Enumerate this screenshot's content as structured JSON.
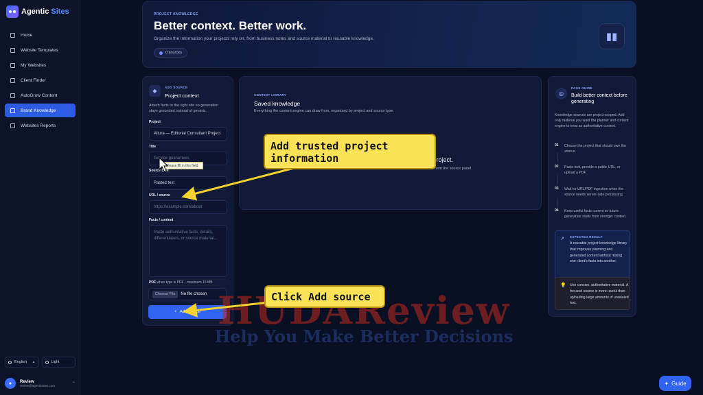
{
  "brand": {
    "name_a": "Agentic",
    "name_b": "Sites"
  },
  "sidebar": {
    "items": [
      {
        "label": "Home"
      },
      {
        "label": "Website Templates"
      },
      {
        "label": "My Websites"
      },
      {
        "label": "Client Finder"
      },
      {
        "label": "AutoGrow Content"
      },
      {
        "label": "Brand Knowledge"
      },
      {
        "label": "Websites Reports"
      }
    ],
    "active_index": 5,
    "language": "English",
    "theme": "Light"
  },
  "user": {
    "name": "Review",
    "email": "review@agenticsites.com"
  },
  "hero": {
    "eyebrow": "PROJECT KNOWLEDGE",
    "title": "Better context. Better work.",
    "description": "Organize the information your projects rely on, from business notes and source material to reusable knowledge.",
    "badge": "0 sources"
  },
  "add_source": {
    "eyebrow": "ADD SOURCE",
    "title": "Project context",
    "description": "Attach facts to the right site so generation stays grounded instead of generic.",
    "project_label": "Project",
    "project_value": "Altura — Editorial Consultant Project",
    "title_label": "Title",
    "title_placeholder": "Service guarantees",
    "validation_tooltip": "Please fill in this field.",
    "source_type_label": "Source type",
    "source_type_value": "Pasted text",
    "url_label": "URL / source",
    "url_placeholder": "https://example.com/about",
    "facts_label": "Facts / content",
    "facts_placeholder": "Paste authoritative facts, details, differentiators, or source material...",
    "pdf_label": "PDF",
    "pdf_sublabel": "when type is PDF · maximum 15 MB",
    "file_button": "Choose File",
    "file_status": "No file chosen",
    "submit": "Add source"
  },
  "library": {
    "eyebrow": "CONTEXT LIBRARY",
    "title": "Saved knowledge",
    "description": "Everything the content engine can draw from, organized by project and source type.",
    "empty_title": "a project.",
    "empty_desc": "from the source panel."
  },
  "guide": {
    "eyebrow": "PAGE GUIDE",
    "title": "Build better context before generating",
    "description": "Knowledge sources are project-scoped. Add only material you want the planner and content engine to treat as authoritative context.",
    "steps": [
      {
        "num": "01",
        "text": "Choose the project that should own the source."
      },
      {
        "num": "02",
        "text": "Paste text, provide a public URL, or upload a PDF."
      },
      {
        "num": "03",
        "text": "Wait for URL/PDF ingestion when the source needs server-side processing."
      },
      {
        "num": "04",
        "text": "Keep useful facts current so future generation starts from stronger context."
      }
    ],
    "result_eyebrow": "EXPECTED RESULT",
    "result_text": "A reusable project knowledge library that improves planning and generated content without mixing one client's facts into another.",
    "tip_text": "Use concise, authoritative material. A focused source is more useful than uploading large amounts of unrelated text."
  },
  "callouts": {
    "one": "Add trusted project information",
    "two": "Click Add source"
  },
  "watermark": {
    "main": "HUDAReview",
    "sub": "Help You Make Better Decisions"
  },
  "guide_button": "Guide",
  "colors": {
    "accent": "#2f63f0",
    "background": "#0a1024",
    "callout": "#fbe257"
  }
}
